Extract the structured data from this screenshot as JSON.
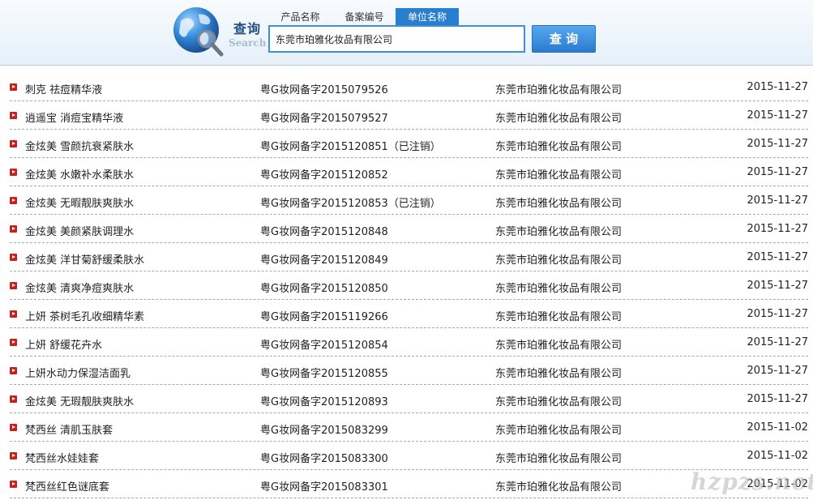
{
  "header": {
    "title": "查询",
    "subtitle": "Search",
    "tabs": [
      {
        "label": "产品名称",
        "active": false
      },
      {
        "label": "备案编号",
        "active": false
      },
      {
        "label": "单位名称",
        "active": true
      }
    ],
    "search_value": "东莞市珀雅化妆品有限公司",
    "search_button": "查 询"
  },
  "results": [
    {
      "name": "刺克 祛痘精华液",
      "reg": "粤G妆网备字2015079526",
      "company": "东莞市珀雅化妆品有限公司",
      "date": "2015-11-27"
    },
    {
      "name": "逍遥宝 消痘宝精华液",
      "reg": "粤G妆网备字2015079527",
      "company": "东莞市珀雅化妆品有限公司",
      "date": "2015-11-27"
    },
    {
      "name": "金炫美 雪颜抗衰紧肤水",
      "reg": "粤G妆网备字2015120851（已注销）",
      "company": "东莞市珀雅化妆品有限公司",
      "date": "2015-11-27"
    },
    {
      "name": "金炫美 水嫩补水柔肤水",
      "reg": "粤G妆网备字2015120852",
      "company": "东莞市珀雅化妆品有限公司",
      "date": "2015-11-27"
    },
    {
      "name": "金炫美 无暇靓肤爽肤水",
      "reg": "粤G妆网备字2015120853（已注销）",
      "company": "东莞市珀雅化妆品有限公司",
      "date": "2015-11-27"
    },
    {
      "name": "金炫美 美颜紧肤调理水",
      "reg": "粤G妆网备字2015120848",
      "company": "东莞市珀雅化妆品有限公司",
      "date": "2015-11-27"
    },
    {
      "name": "金炫美 洋甘菊舒缓柔肤水",
      "reg": "粤G妆网备字2015120849",
      "company": "东莞市珀雅化妆品有限公司",
      "date": "2015-11-27"
    },
    {
      "name": "金炫美 清爽净痘爽肤水",
      "reg": "粤G妆网备字2015120850",
      "company": "东莞市珀雅化妆品有限公司",
      "date": "2015-11-27"
    },
    {
      "name": "上妍 茶树毛孔收细精华素",
      "reg": "粤G妆网备字2015119266",
      "company": "东莞市珀雅化妆品有限公司",
      "date": "2015-11-27"
    },
    {
      "name": "上妍 舒缓花卉水",
      "reg": "粤G妆网备字2015120854",
      "company": "东莞市珀雅化妆品有限公司",
      "date": "2015-11-27"
    },
    {
      "name": "上妍水动力保湿洁面乳",
      "reg": "粤G妆网备字2015120855",
      "company": "东莞市珀雅化妆品有限公司",
      "date": "2015-11-27"
    },
    {
      "name": "金炫美 无瑕靓肤爽肤水",
      "reg": "粤G妆网备字2015120893",
      "company": "东莞市珀雅化妆品有限公司",
      "date": "2015-11-27"
    },
    {
      "name": "梵西丝 清肌玉肤套",
      "reg": "粤G妆网备字2015083299",
      "company": "东莞市珀雅化妆品有限公司",
      "date": "2015-11-02"
    },
    {
      "name": "梵西丝水娃娃套",
      "reg": "粤G妆网备字2015083300",
      "company": "东莞市珀雅化妆品有限公司",
      "date": "2015-11-02"
    },
    {
      "name": "梵西丝红色谜底套",
      "reg": "粤G妆网备字2015083301",
      "company": "东莞市珀雅化妆品有限公司",
      "date": "2015-11-02"
    }
  ],
  "watermark": "hzpzs.net"
}
